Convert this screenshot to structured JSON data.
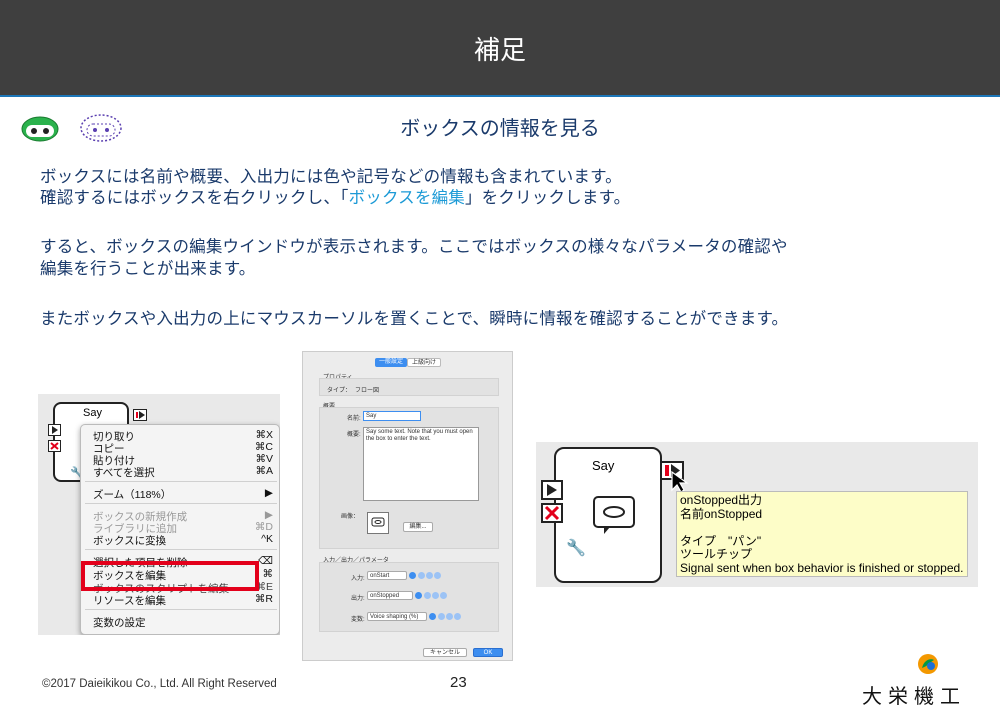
{
  "header": {
    "title": "補足"
  },
  "subtitle": "ボックスの情報を見る",
  "paragraphs": {
    "p1_line1": "ボックスには名前や概要、入出力には色や記号などの情報も含まれています。",
    "p1_line2_pre": "確認するにはボックスを右クリックし、「",
    "p1_line2_link": "ボックスを編集",
    "p1_line2_post": "」をクリックします。",
    "p2_line1": "すると、ボックスの編集ウインドウが表示されます。ここではボックスの様々なパラメータの確認や",
    "p2_line2": "編集を行うことが出来ます。",
    "p3_line1": "またボックスや入出力の上にマウスカーソルを置くことで、瞬時に情報を確認することができます。"
  },
  "shot1": {
    "box_name": "Say",
    "menu": [
      {
        "label": "切り取り",
        "shortcut": "⌘X"
      },
      {
        "label": "コピー",
        "shortcut": "⌘C"
      },
      {
        "label": "貼り付け",
        "shortcut": "⌘V"
      },
      {
        "label": "すべてを選択",
        "shortcut": "⌘A"
      },
      {
        "label": "ズーム（118%）",
        "shortcut": "▶"
      },
      {
        "label": "ボックスの新規作成",
        "shortcut": "▶"
      },
      {
        "label": "ライブラリに追加",
        "shortcut": "⌘D"
      },
      {
        "label": "ボックスに変換",
        "shortcut": "^K"
      },
      {
        "label": "選択した項目を削除",
        "shortcut": "⌫"
      },
      {
        "label": "ボックスを編集",
        "shortcut": "⌘"
      },
      {
        "label": "ボックスのスクリプトを編集",
        "shortcut": "⌘E"
      },
      {
        "label": "リソースを編集",
        "shortcut": "⌘R"
      },
      {
        "label": "変数の設定",
        "shortcut": ""
      }
    ]
  },
  "shot2": {
    "tab_general": "一般設定",
    "tab_advanced": "上級向け",
    "section_property": "プロパティ",
    "type_label": "タイプ：",
    "type_value": "フロー図",
    "section_overview": "概要",
    "name_label": "名前:",
    "name_value": "Say",
    "desc_label": "概要:",
    "desc_value": "Say some text. Note that you must open the box to enter the text.",
    "image_label": "画像：",
    "edit_button": "編集...",
    "section_io": "入力／出力／パラメータ",
    "input_label": "入力:",
    "input_value": "onStart",
    "output_label": "出力:",
    "output_value": "onStopped",
    "var_label": "変数:",
    "var_value": "Voice shaping (%)",
    "cancel_button": "キャンセル",
    "ok_button": "OK"
  },
  "shot3": {
    "box_name": "Say",
    "tooltip_lines": [
      "onStopped出力",
      "名前onStopped",
      "",
      "タイプ　\"パン\"",
      "ツールチップ",
      "Signal sent when box behavior is finished or stopped."
    ]
  },
  "footer": {
    "copyright": "©2017 Daieikikou Co., Ltd. All Right Reserved",
    "page_number": "23",
    "logo_text": "大栄機工"
  }
}
